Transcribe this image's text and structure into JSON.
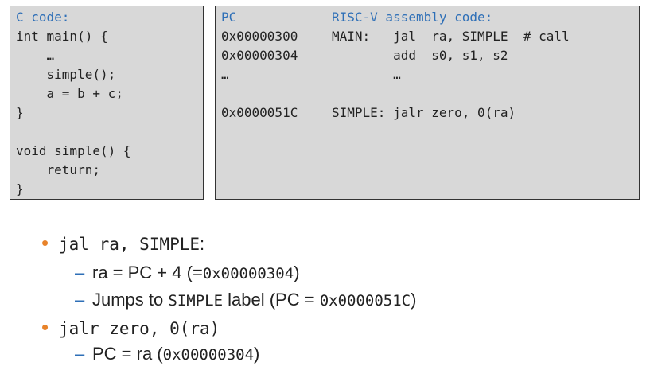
{
  "c_panel": {
    "header": "C code:",
    "lines": [
      "int main() {",
      "    …",
      "    simple();",
      "    a = b + c;",
      "}",
      "",
      "void simple() {",
      "    return;",
      "}"
    ]
  },
  "asm_panel": {
    "pc_header": "PC",
    "asm_header": "RISC-V assembly code:",
    "rows": [
      {
        "pc": "0x00000300",
        "code": "MAIN:   jal  ra, SIMPLE  # call"
      },
      {
        "pc": "0x00000304",
        "code": "        add  s0, s1, s2"
      },
      {
        "pc": "…",
        "code": "        …"
      },
      {
        "pc": "",
        "code": ""
      },
      {
        "pc": "0x0000051C",
        "code": "SIMPLE: jalr zero, 0(ra)"
      }
    ]
  },
  "bullets": {
    "b1_code": "jal  ra, SIMPLE",
    "b1_colon": ":",
    "b1_sub1_pre": "ra = PC + 4 (=",
    "b1_sub1_code": "0x00000304",
    "b1_sub1_post": ")",
    "b1_sub2_pre": "Jumps to ",
    "b1_sub2_code1": "SIMPLE",
    "b1_sub2_mid": " label (PC = ",
    "b1_sub2_code2": "0x0000051C",
    "b1_sub2_post": ")",
    "b2_code": "jalr zero, 0(ra)",
    "b2_sub1_pre": "PC = ra (",
    "b2_sub1_code": "0x00000304",
    "b2_sub1_post": ")"
  },
  "colors": {
    "accent_blue": "#2e6fb7",
    "bullet_orange": "#e8832a",
    "panel_bg": "#d8d8d8"
  }
}
